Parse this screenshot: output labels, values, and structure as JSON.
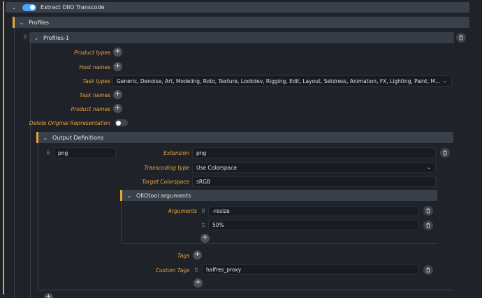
{
  "root": {
    "title": "Extract OIIO Transcode",
    "enabled": true
  },
  "profiles_header": "Profiles",
  "profile_item": {
    "title": "Profiles-1"
  },
  "profile_fields": {
    "product_types": "Product types",
    "host_names": "Host names",
    "task_types": "Task types",
    "task_types_value": "Generic, Denoise, Art, Modeling, Roto, Texture, Lookdev, Rigging, Edit, Layout, Setdress, Animation, FX, Lighting, Paint, Matchmove, Templa...",
    "task_names": "Task names",
    "product_names": "Product names",
    "delete_original": "Delete Original Representation",
    "delete_original_value": false
  },
  "output_definitions": {
    "header": "Output Definitions",
    "name_value": "png",
    "extension_label": "Extension",
    "extension_value": "png",
    "transcoding_type_label": "Transcoding type",
    "transcoding_type_value": "Use Colorspace",
    "target_colorspace_label": "Target Colorspace",
    "target_colorspace_value": "sRGB",
    "oiiotool_header": "OIIOtool arguments",
    "arguments_label": "Arguments",
    "arguments": [
      "-resize",
      "50%"
    ],
    "tags_label": "Tags",
    "custom_tags_label": "Custom Tags",
    "custom_tags": [
      "halfres_proxy"
    ]
  },
  "colors": {
    "accent": "#e8a33a",
    "toggle_on": "#4aa3ff",
    "toggle_off": "#3f4550"
  },
  "icons": [
    "chevron-down-icon",
    "drag-handle-icon",
    "trash-icon",
    "plus-icon"
  ]
}
